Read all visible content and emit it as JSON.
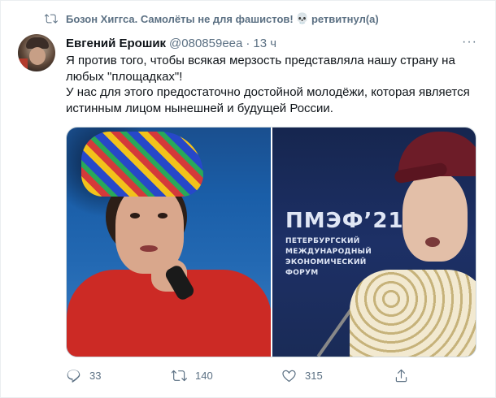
{
  "retweet_banner": {
    "icon": "retweet-icon",
    "name": "Бозон Хиггса. Самолёты не для фашистов!",
    "emoji": "💀",
    "suffix": "ретвитнул(а)"
  },
  "tweet": {
    "author_name": "Евгений Ерошик",
    "handle": "@080859eea",
    "separator": "·",
    "time": "13 ч",
    "more_icon": "more-horizontal-icon",
    "more_label": "···",
    "text_lines": [
      "Я против того, чтобы всякая мерзость представляла нашу страну на",
      "любых \"площадках\"!",
      "У нас для этого предостаточно достойной молодёжи, которая является",
      "истинным лицом нынешней и будущей России."
    ],
    "media": {
      "forum_title": "ПМЭФ’21",
      "forum_lines": [
        "ПЕТЕРБУРГСКИЙ",
        "МЕЖДУНАРОДНЫЙ",
        "ЭКОНОМИЧЕСКИЙ",
        "ФОРУМ"
      ]
    },
    "actions": {
      "replies": "33",
      "retweets": "140",
      "likes": "315"
    }
  },
  "colors": {
    "secondary_text": "#5b7083",
    "primary_text": "#0f1419",
    "border": "#ebeef0"
  }
}
